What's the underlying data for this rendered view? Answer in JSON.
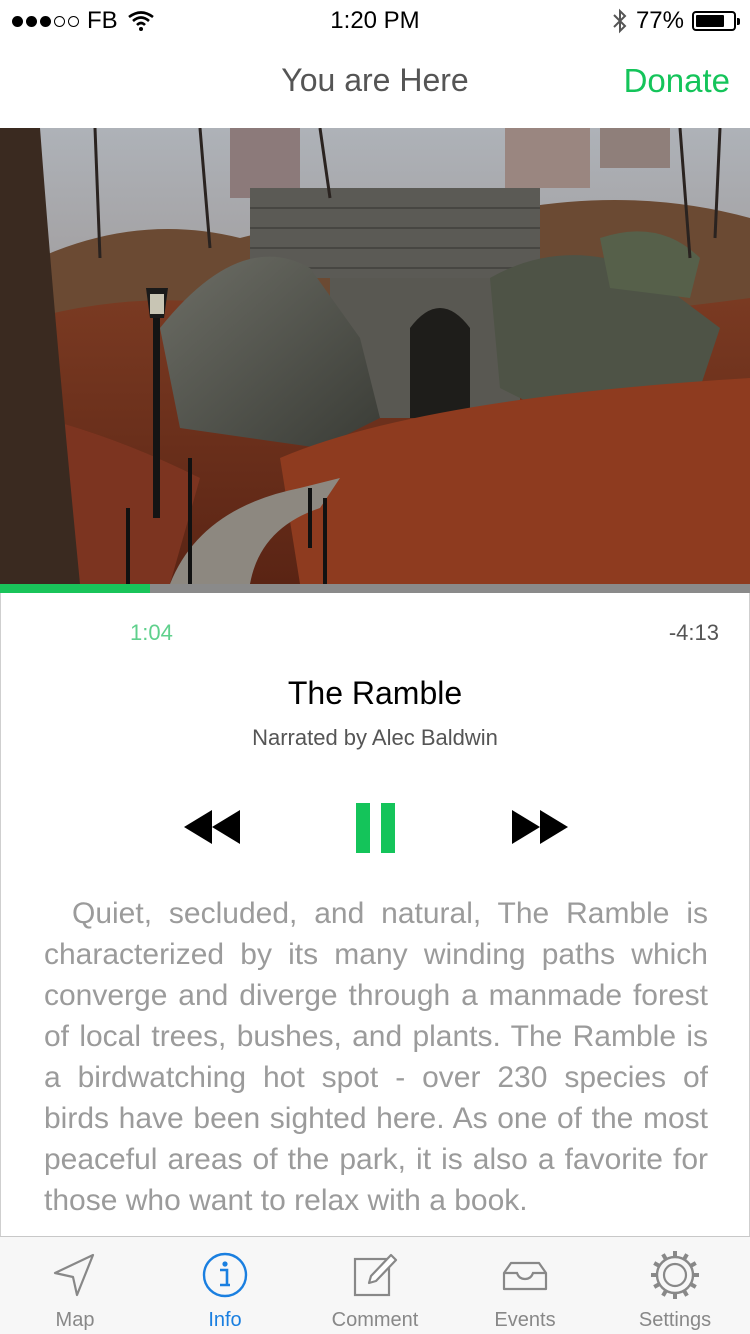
{
  "status_bar": {
    "carrier": "FB",
    "signal_bars_filled": 3,
    "signal_bars_total": 5,
    "time": "1:20 PM",
    "battery_percent": "77%",
    "battery_level": 0.77
  },
  "nav": {
    "title": "You are Here",
    "donate_label": "Donate"
  },
  "player": {
    "progress": 0.2,
    "elapsed": "1:04",
    "remaining": "-4:13",
    "title": "The Ramble",
    "narrator": "Narrated by Alec Baldwin",
    "state": "playing",
    "description": "Quiet, secluded, and natural, The Ramble is characterized by its many winding paths which converge and diverge through a manmade forest of local trees, bushes, and plants. The Ramble is a birdwatching hot spot - over 230 species of birds have been sighted here. As one of the most peaceful areas of the park, it is also a favorite for those who want to relax with a book."
  },
  "colors": {
    "accent_green": "#14c45a",
    "tab_active_blue": "#1a7fe0",
    "text_gray": "#9b9b9b"
  },
  "tabs": [
    {
      "label": "Map",
      "icon": "location-arrow-icon"
    },
    {
      "label": "Info",
      "icon": "info-icon",
      "active": true
    },
    {
      "label": "Comment",
      "icon": "compose-icon"
    },
    {
      "label": "Events",
      "icon": "inbox-tray-icon"
    },
    {
      "label": "Settings",
      "icon": "gear-icon"
    }
  ]
}
